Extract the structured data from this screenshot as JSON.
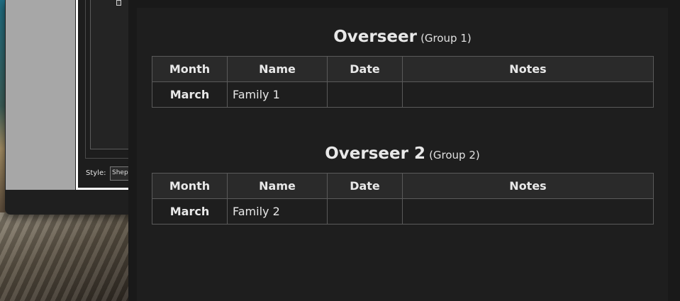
{
  "background_window": {
    "style_label": "Style:",
    "style_value": "Shep"
  },
  "groups": [
    {
      "title": "Overseer",
      "subtitle": "(Group 1)",
      "columns": [
        "Month",
        "Name",
        "Date",
        "Notes"
      ],
      "rows": [
        {
          "month": "March",
          "name": "Family 1",
          "date": "",
          "notes": ""
        }
      ]
    },
    {
      "title": "Overseer 2",
      "subtitle": "(Group 2)",
      "columns": [
        "Month",
        "Name",
        "Date",
        "Notes"
      ],
      "rows": [
        {
          "month": "March",
          "name": "Family 2",
          "date": "",
          "notes": ""
        }
      ]
    }
  ],
  "colors": {
    "panel_bg": "#1e1e1e",
    "header_bg": "#2a2a2a",
    "border": "#5a5a5a",
    "text": "#e8e8e8"
  }
}
